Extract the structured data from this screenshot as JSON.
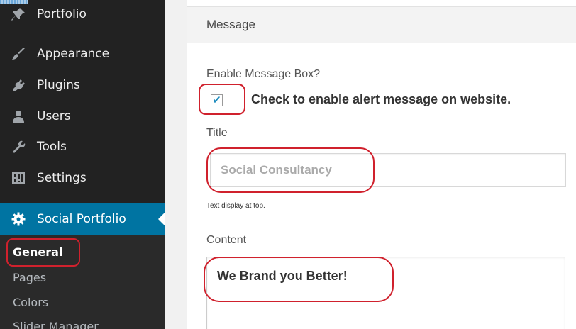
{
  "sidebar": {
    "items": [
      {
        "label": "Portfolio",
        "icon": "pin-icon"
      },
      {
        "label": "Appearance",
        "icon": "paintbrush-icon"
      },
      {
        "label": "Plugins",
        "icon": "plug-icon"
      },
      {
        "label": "Users",
        "icon": "user-icon"
      },
      {
        "label": "Tools",
        "icon": "wrench-icon"
      },
      {
        "label": "Settings",
        "icon": "sliders-icon"
      },
      {
        "label": "Social Portfolio",
        "icon": "gear-icon",
        "active": true
      }
    ],
    "submenu": [
      "General",
      "Pages",
      "Colors",
      "Slider Manager"
    ],
    "active_submenu": "General"
  },
  "section": {
    "title": "Message"
  },
  "fields": {
    "enable_label": "Enable Message Box?",
    "checkbox_checked": true,
    "checkbox_text": "Check to enable alert message on website.",
    "title_label": "Title",
    "title_value": "Social Consultancy",
    "title_description": "Text display at top.",
    "content_label": "Content",
    "content_value": "We Brand you Better!"
  },
  "colors": {
    "sidebar_bg": "#222222",
    "active_menu": "#0074a2",
    "annotation": "#d0212d",
    "checkmark": "#1e8cbe"
  }
}
